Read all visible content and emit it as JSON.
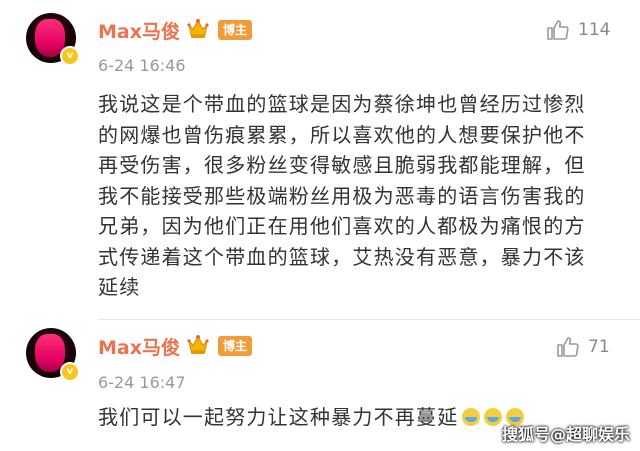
{
  "comments": [
    {
      "username": "Max马俊",
      "role_badge": "博主",
      "verified_mark": "v",
      "timestamp": "6-24 16:46",
      "likes": "114",
      "text": "我说这是个带血的篮球是因为蔡徐坤也曾经历过惨烈的网爆也曾伤痕累累，所以喜欢他的人想要保护他不再受伤害，很多粉丝变得敏感且脆弱我都能理解，但我不能接受那些极端粉丝用极为恶毒的语言伤害我的兄弟，因为他们正在用他们喜欢的人都极为痛恨的方式传递着这个带血的篮球，艾热没有恶意，暴力不该延续"
    },
    {
      "username": "Max马俊",
      "role_badge": "博主",
      "verified_mark": "v",
      "timestamp": "6-24 16:47",
      "likes": "71",
      "text": "我们可以一起努力让这种暴力不再蔓延"
    }
  ],
  "watermark": "搜狐号@超聊娱乐",
  "icons": {
    "like": "thumbs-up-icon",
    "crown": "crown-icon",
    "emoji": "smiley-emoji"
  },
  "colors": {
    "username": "#eb7350",
    "badge": "#f19b39",
    "text": "#333333",
    "meta": "#999999"
  }
}
